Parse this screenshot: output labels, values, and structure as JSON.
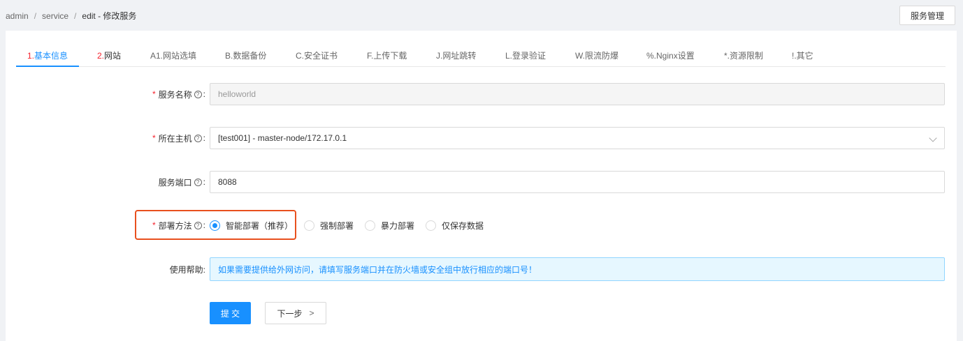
{
  "breadcrumb": {
    "items": [
      "admin",
      "service"
    ],
    "current": "edit - 修改服务"
  },
  "header": {
    "manage_button": "服务管理"
  },
  "tabs": [
    {
      "prefix": "1.",
      "label": "基本信息",
      "active": true
    },
    {
      "prefix": "2.",
      "label": "网站",
      "active": false
    },
    {
      "prefix": "A1.",
      "label": "网站选填",
      "active": false
    },
    {
      "prefix": "B.",
      "label": "数据备份",
      "active": false
    },
    {
      "prefix": "C.",
      "label": "安全证书",
      "active": false
    },
    {
      "prefix": "F.",
      "label": "上传下载",
      "active": false
    },
    {
      "prefix": "J.",
      "label": "网址跳转",
      "active": false
    },
    {
      "prefix": "L.",
      "label": "登录验证",
      "active": false
    },
    {
      "prefix": "W.",
      "label": "限流防爆",
      "active": false
    },
    {
      "prefix": "%.",
      "label": "Nginx设置",
      "active": false
    },
    {
      "prefix": "*.",
      "label": "资源限制",
      "active": false
    },
    {
      "prefix": "!.",
      "label": "其它",
      "active": false
    }
  ],
  "form": {
    "service_name": {
      "label": "服务名称",
      "value": "helloworld"
    },
    "host": {
      "label": "所在主机",
      "value": "[test001] - master-node/172.17.0.1"
    },
    "port": {
      "label": "服务端口",
      "value": "8088"
    },
    "deploy": {
      "label": "部署方法",
      "options": [
        "智能部署（推荐）",
        "强制部署",
        "暴力部署",
        "仅保存数据"
      ],
      "selected": "智能部署（推荐）"
    },
    "help": {
      "label": "使用帮助:",
      "text": "如果需要提供给外网访问，请填写服务端口并在防火墙或安全组中放行相应的端口号！"
    }
  },
  "buttons": {
    "submit": "提 交",
    "next": "下一步"
  },
  "colors": {
    "primary": "#1890ff",
    "required": "#f5222d",
    "highlight": "#e8501e"
  }
}
